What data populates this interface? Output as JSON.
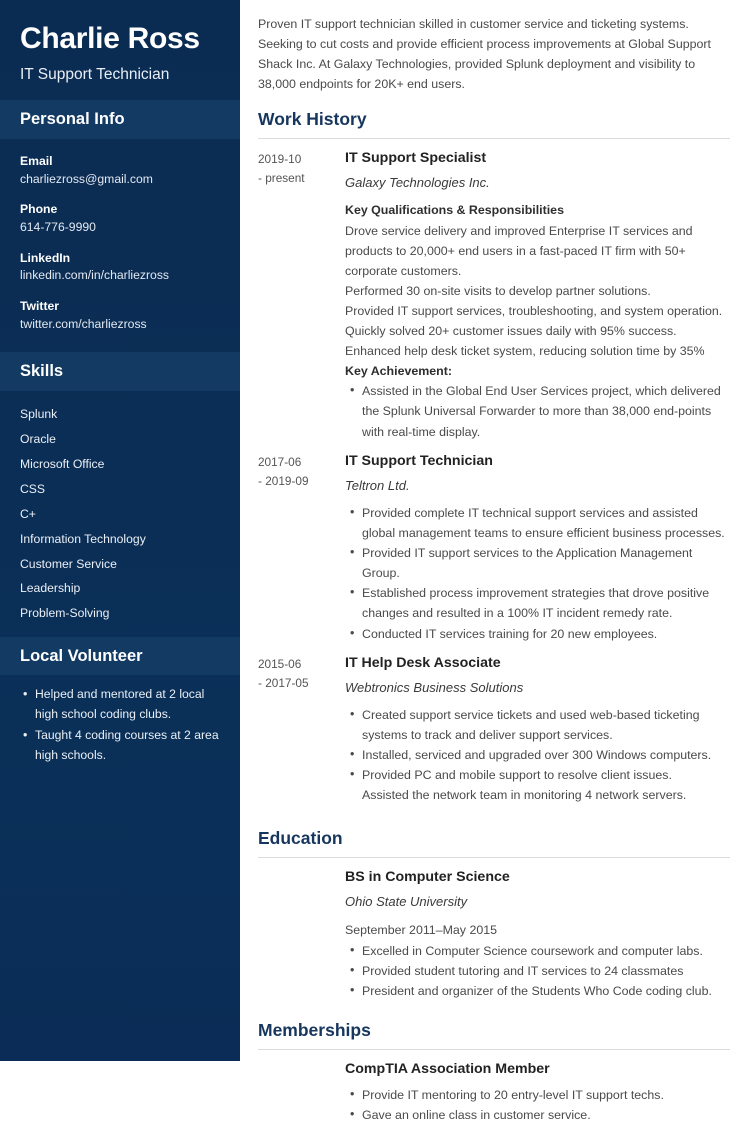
{
  "sidebar": {
    "full_name": "Charlie Ross",
    "job_title": "IT Support Technician",
    "personal_info": {
      "heading": "Personal Info",
      "items": [
        {
          "label": "Email",
          "value": "charliezross@gmail.com"
        },
        {
          "label": "Phone",
          "value": "614-776-9990"
        },
        {
          "label": "LinkedIn",
          "value": "linkedin.com/in/charliezross"
        },
        {
          "label": "Twitter",
          "value": "twitter.com/charliezross"
        }
      ]
    },
    "skills": {
      "heading": "Skills",
      "items": [
        "Splunk",
        "Oracle",
        "Microsoft Office",
        "CSS",
        "C+",
        "Information Technology",
        "Customer Service",
        "Leadership",
        "Problem-Solving"
      ]
    },
    "volunteer": {
      "heading": "Local Volunteer",
      "items": [
        "Helped and mentored at 2 local high school coding clubs.",
        "Taught 4 coding courses at 2 area high schools."
      ]
    }
  },
  "main": {
    "summary": "Proven IT support technician skilled in customer service and ticketing systems. Seeking to cut costs and provide efficient process improvements at Global Support Shack Inc. At Galaxy Technologies, provided Splunk deployment and visibility to 38,000 endpoints for 20K+ end users.",
    "work_history": {
      "heading": "Work History",
      "entries": [
        {
          "dates_start": "2019-10",
          "dates_end": "- present",
          "title": "IT Support Specialist",
          "organization": "Galaxy Technologies Inc.",
          "subhead": "Key Qualifications & Responsibilities",
          "lines": [
            "Drove service delivery and improved Enterprise IT services and products to 20,000+ end users in a fast-paced IT firm with 50+ corporate customers.",
            "Performed 30 on-site visits to develop partner solutions.",
            "Provided IT support services, troubleshooting, and system operation.",
            "Quickly solved 20+ customer issues daily with 95% success.",
            "Enhanced help desk ticket system, reducing solution time by 35%"
          ],
          "achievement_label": "Key Achievement:",
          "achievements": [
            "Assisted in the Global End User Services project, which delivered the Splunk Universal Forwarder to more than 38,000 end-points with real-time display."
          ]
        },
        {
          "dates_start": "2017-06",
          "dates_end": "- 2019-09",
          "title": "IT Support Technician",
          "organization": "Teltron Ltd.",
          "bullets": [
            "Provided complete IT technical support services and assisted global management teams to ensure efficient business processes.",
            "Provided IT support services to the Application Management Group.",
            "Established process improvement strategies that drove positive changes and resulted in a 100% IT incident remedy rate.",
            "Conducted IT services training for 20 new employees."
          ]
        },
        {
          "dates_start": "2015-06",
          "dates_end": "- 2017-05",
          "title": "IT Help Desk Associate",
          "organization": "Webtronics Business Solutions",
          "bullets": [
            "Created support service tickets and used web-based ticketing systems to track and deliver support services.",
            "Installed, serviced and upgraded over 300 Windows computers.",
            "Provided PC and mobile support to resolve client issues."
          ],
          "trailing_line": "Assisted the network team in monitoring 4 network servers."
        }
      ]
    },
    "education": {
      "heading": "Education",
      "degree": "BS in Computer Science",
      "school": "Ohio State University",
      "date_range": "September 2011–May 2015",
      "bullets": [
        "Excelled in Computer Science coursework and computer labs.",
        "Provided student tutoring and IT services to 24 classmates",
        "President and organizer of the Students Who Code coding club."
      ]
    },
    "memberships": {
      "heading": "Memberships",
      "title": "CompTIA Association Member",
      "bullets": [
        "Provide IT mentoring to 20 entry-level IT support techs.",
        "Gave an online class in customer service."
      ]
    }
  }
}
